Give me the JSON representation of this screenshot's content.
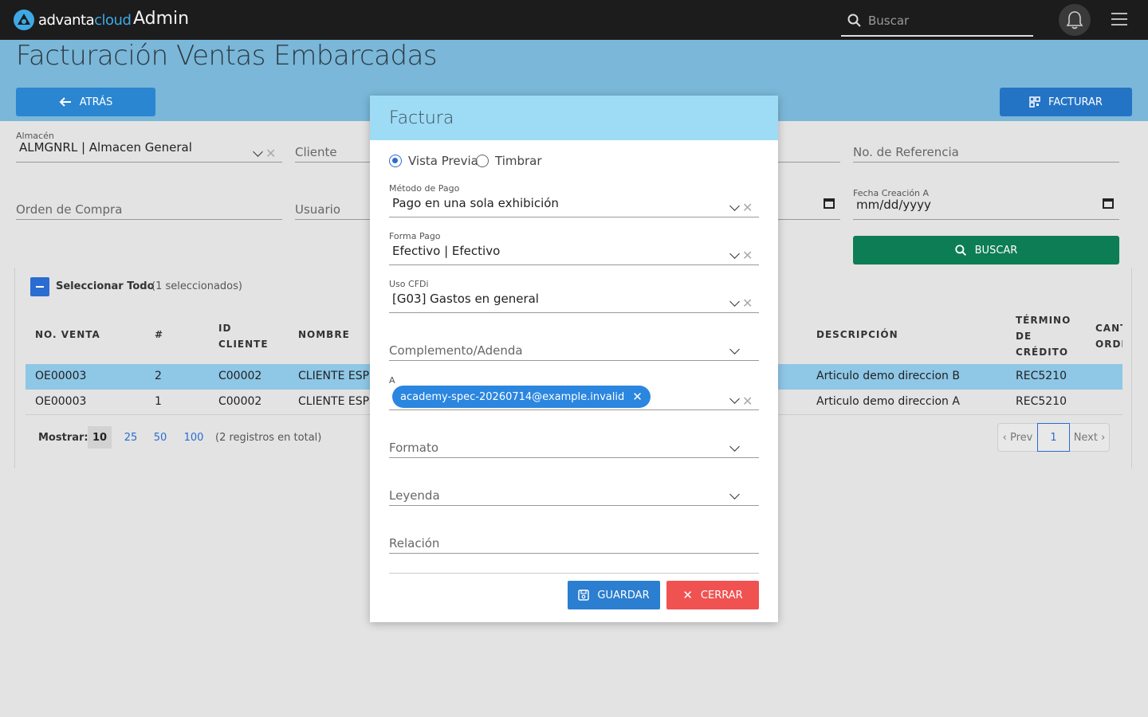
{
  "header": {
    "logo_prefix": "advanta",
    "logo_suffix": "cloud",
    "app_title": "Admin",
    "search_placeholder": "Buscar"
  },
  "page": {
    "title": "Facturación Ventas Embarcadas",
    "back_label": "ATRÁS",
    "invoice_label": "FACTURAR",
    "search_button_label": "BUSCAR"
  },
  "filters": {
    "almacen_label": "Almacén",
    "almacen_value": "ALMGNRL | Almacen General",
    "cliente": "Cliente",
    "referencia": "No. de Referencia",
    "orden_compra": "Orden de Compra",
    "usuario": "Usuario",
    "fecha_a_label": "Fecha Creación A",
    "fecha_a_value": "mm/dd/yyyy"
  },
  "table": {
    "select_all": "Seleccionar Todo",
    "selected_count": "(1 seleccionados)",
    "headers": {
      "no_venta": "NO. VENTA",
      "num": "#",
      "id_cliente_1": "ID",
      "id_cliente_2": "CLIENTE",
      "nombre": "NOMBRE",
      "descripcion": "DESCRIPCIÓN",
      "termino_1": "TÉRMINO",
      "termino_2": "DE",
      "termino_3": "CRÉDITO",
      "cant_1": "CANT",
      "cant_2": "ORDE"
    },
    "rows": [
      {
        "no_venta": "OE00003",
        "num": "2",
        "id_cliente": "C00002",
        "nombre": "CLIENTE ESPE",
        "descripcion": "Articulo demo direccion B",
        "termino": "REC5210"
      },
      {
        "no_venta": "OE00003",
        "num": "1",
        "id_cliente": "C00002",
        "nombre": "CLIENTE ESPE",
        "descripcion": "Articulo demo direccion A",
        "termino": "REC5210"
      }
    ],
    "show_label": "Mostrar:",
    "page_sizes": [
      "10",
      "25",
      "50",
      "100"
    ],
    "total": "(2 registros en total)",
    "prev": "‹ Prev",
    "page": "1",
    "next": "Next ›"
  },
  "modal": {
    "title": "Factura",
    "radio_preview": "Vista Previa",
    "radio_stamp": "Timbrar",
    "metodo_label": "Método de Pago",
    "metodo_value": "Pago en una sola exhibición",
    "forma_label": "Forma Pago",
    "forma_value": "Efectivo | Efectivo",
    "uso_label": "Uso CFDi",
    "uso_value": "[G03] Gastos en general",
    "complemento": "Complemento/Adenda",
    "a_label": "A",
    "a_chip": "academy-spec-20260714@example.invalid",
    "formato": "Formato",
    "leyenda": "Leyenda",
    "relacion": "Relación",
    "save": "GUARDAR",
    "close": "CERRAR"
  },
  "colors": {
    "topbar": "#1c1c1c",
    "banner": "#7ab7d8",
    "primary": "#2b86d2",
    "success": "#0d7d55",
    "danger": "#f05252",
    "modal_header": "#9edcf5",
    "selected_row": "#8fc7e6"
  }
}
